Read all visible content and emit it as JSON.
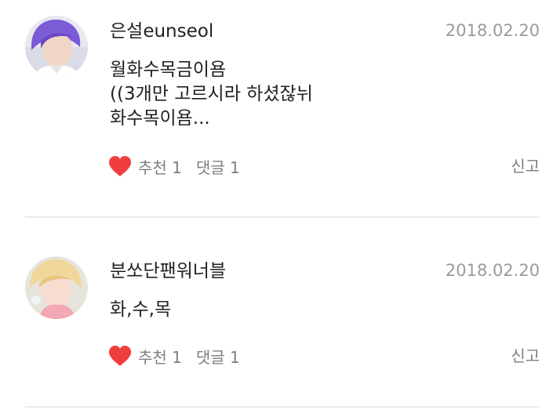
{
  "comments": [
    {
      "username": "은설eunseol",
      "date": "2018.02.20",
      "body_lines": [
        "월화수목금이욤",
        "((3개만 고르시라 하셨잖뉘",
        "화수목이욤..."
      ],
      "like_label": "추천 1",
      "reply_label": "댓글 1",
      "report_label": "신고",
      "avatar_icon": "profile-photo-purple-hair",
      "heart_icon": "heart-icon",
      "heart_color": "#f03d3d"
    },
    {
      "username": "분쏘단팬워너블",
      "date": "2018.02.20",
      "body_lines": [
        "화,수,목"
      ],
      "like_label": "추천 1",
      "reply_label": "댓글 1",
      "report_label": "신고",
      "avatar_icon": "profile-photo-blond-hair",
      "heart_icon": "heart-icon",
      "heart_color": "#f03d3d"
    }
  ],
  "colors": {
    "text": "#222222",
    "meta": "#9a9a9a",
    "action": "#7d7d7d",
    "divider": "#e6ecef"
  }
}
